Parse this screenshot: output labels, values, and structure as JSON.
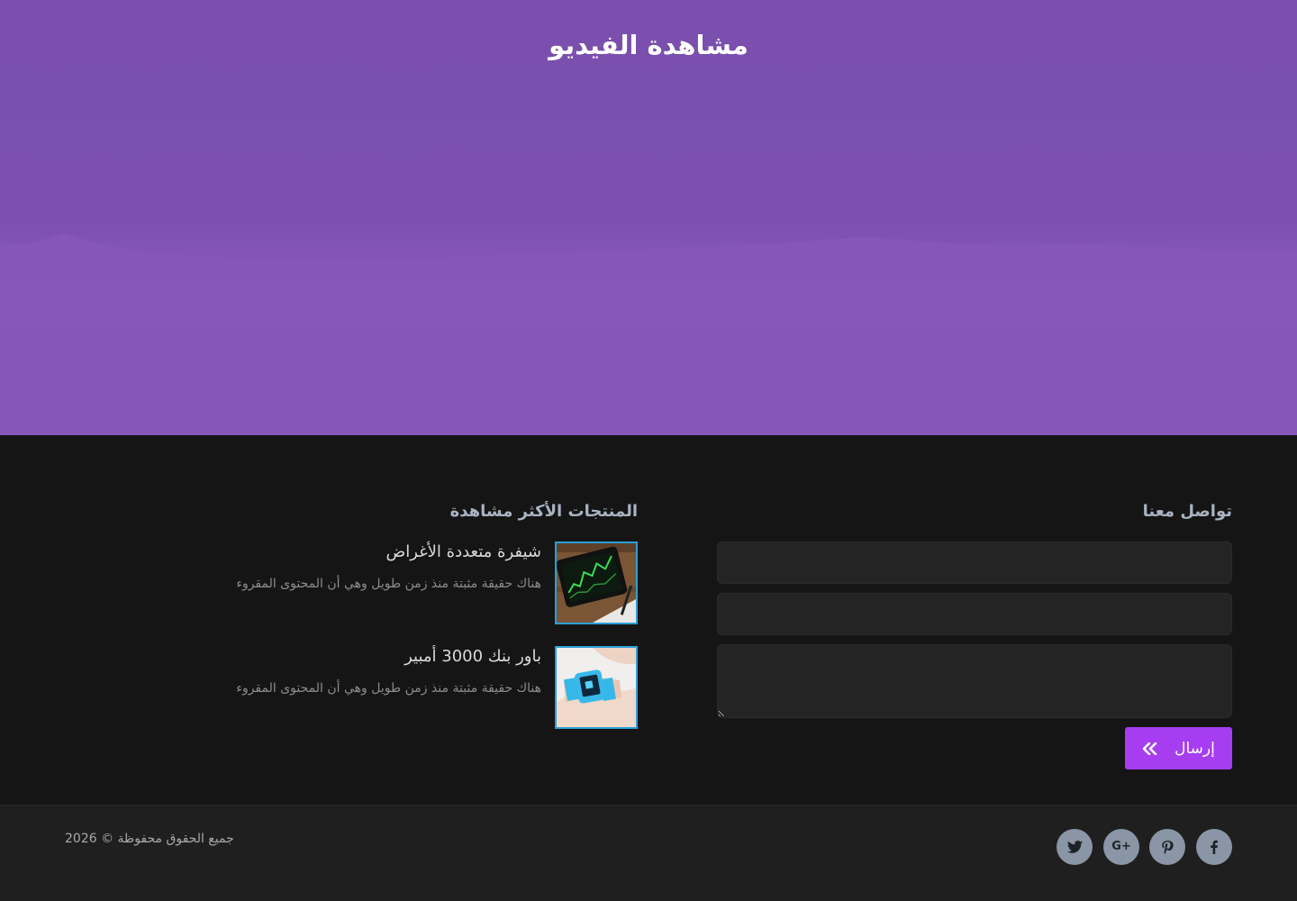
{
  "hero": {
    "title": "مشاهدة الفيديو"
  },
  "contact": {
    "title": "تواصل معنا",
    "name_value": "",
    "email_value": "",
    "message_value": "",
    "send_label": "إرسال",
    "send_icon": "double-chevron-left-icon"
  },
  "products": {
    "title": "المنتجات الأكثر مشاهدة",
    "items": [
      {
        "name": "شيفرة متعددة الأغراض",
        "description": "هناك حقيقة مثبتة منذ زمن طويل وهي أن المحتوى المقروء",
        "thumb": "tablet-chart-image"
      },
      {
        "name": "باور بنك 3000 أمبير",
        "description": "هناك حقيقة مثبتة منذ زمن طويل وهي أن المحتوى المقروء",
        "thumb": "smartwatch-image"
      }
    ]
  },
  "footer": {
    "copyright": "جميع الحقوق محفوظة © 2026",
    "social": [
      {
        "name": "facebook",
        "icon": "facebook-icon"
      },
      {
        "name": "pinterest",
        "icon": "pinterest-icon"
      },
      {
        "name": "google-plus",
        "icon": "google-plus-icon",
        "text": "G+"
      },
      {
        "name": "twitter",
        "icon": "twitter-icon"
      }
    ]
  },
  "colors": {
    "hero_purple": "#7b50ae",
    "accent": "#a63df0",
    "thumb_border": "#2c9fd6",
    "social_bg": "#8a96a5",
    "footer_bg": "#151515",
    "bottom_bar_bg": "#1f1f1f"
  }
}
